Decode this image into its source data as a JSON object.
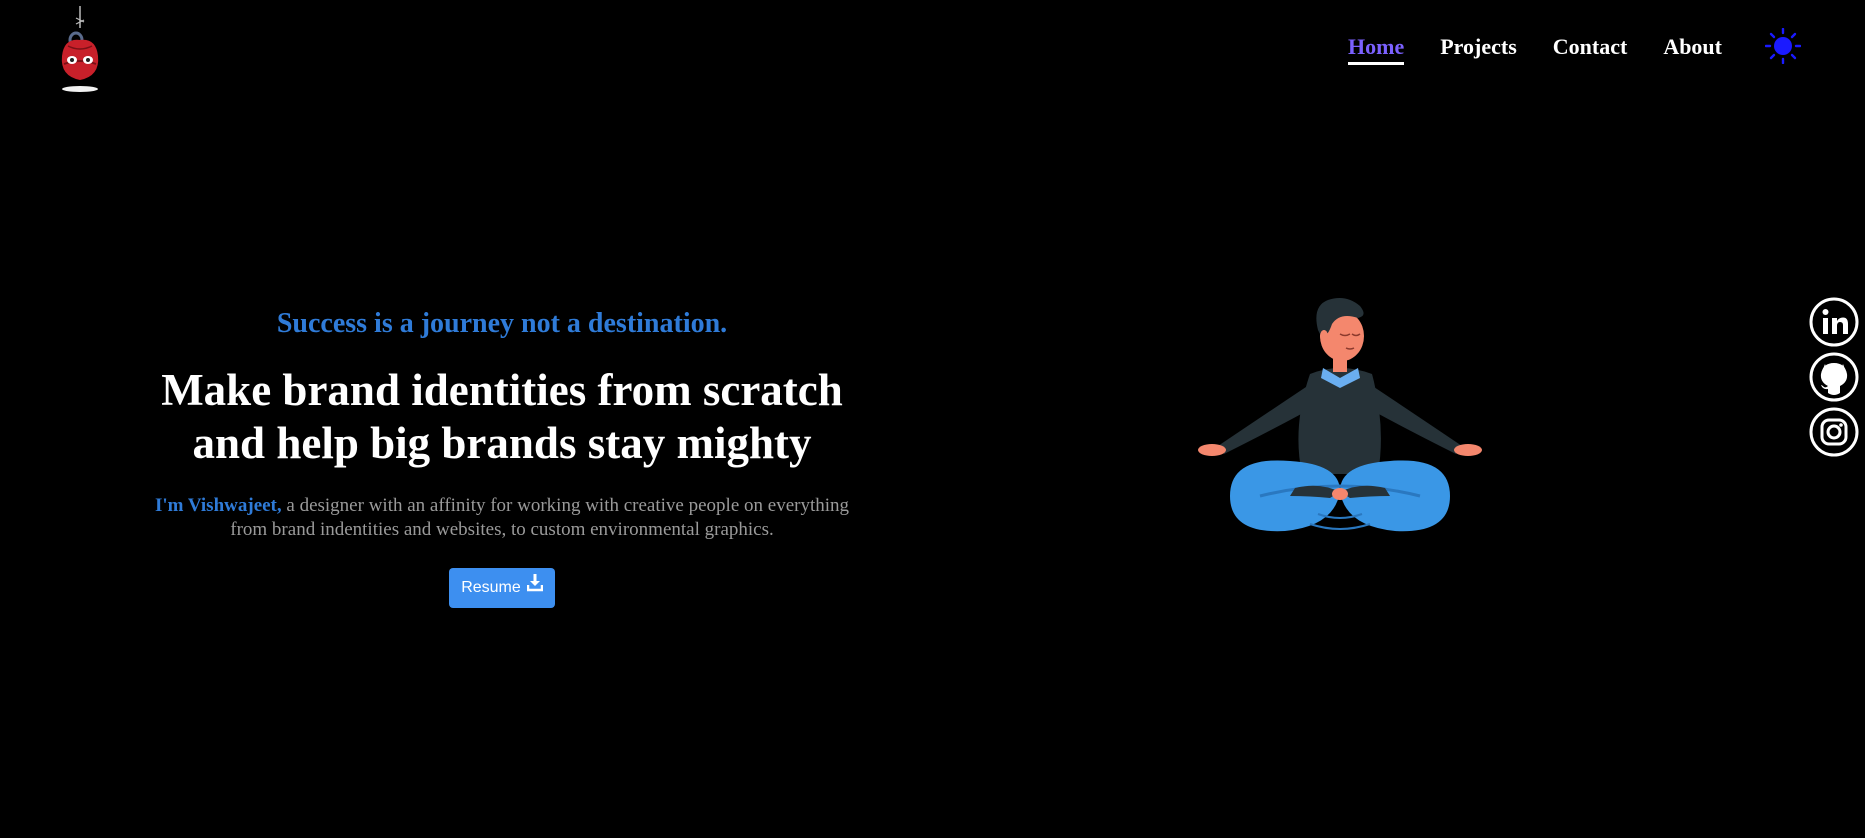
{
  "header": {
    "logo_icon": "hanging-spider-mascot-icon",
    "nav": [
      {
        "label": "Home",
        "active": true
      },
      {
        "label": "Projects",
        "active": false
      },
      {
        "label": "Contact",
        "active": false
      },
      {
        "label": "About",
        "active": false
      }
    ],
    "theme_toggle_icon": "sun-icon"
  },
  "hero": {
    "quote": "Success is a journey not a destination.",
    "headline_line1": "Make brand identities from scratch",
    "headline_line2": "and help big brands stay mighty",
    "intro_name": "I'm Vishwajeet,",
    "intro_text": " a designer with an affinity for working with creative people on everything from brand indentities and websites, to custom environmental graphics.",
    "resume_label": "Resume",
    "resume_icon": "download-icon"
  },
  "illustration": {
    "icon": "meditating-person-illustration"
  },
  "social": [
    {
      "icon": "linkedin-icon"
    },
    {
      "icon": "github-icon"
    },
    {
      "icon": "instagram-icon"
    }
  ],
  "colors": {
    "background": "#000000",
    "accent_blue": "#2f7bd8",
    "nav_active": "#7b61ff",
    "button": "#3d8ff0",
    "theme_toggle": "#1a1aff"
  }
}
